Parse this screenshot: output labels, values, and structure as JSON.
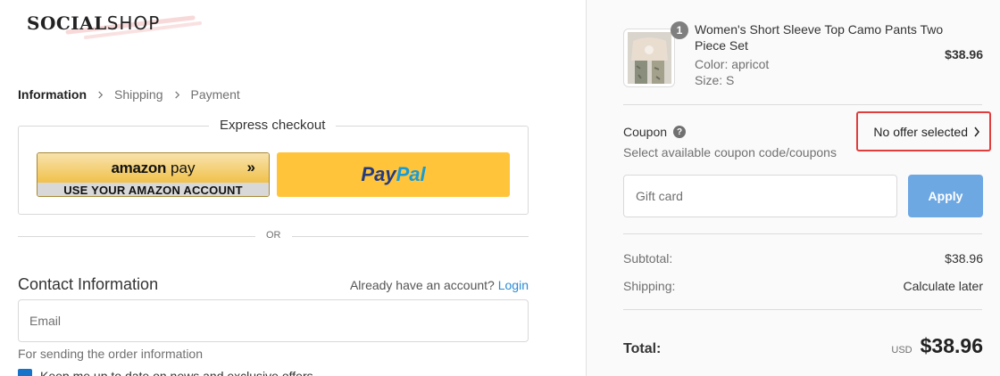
{
  "brand": {
    "logo_bold": "SOCIAL",
    "logo_light": "SHOP"
  },
  "breadcrumb": [
    {
      "label": "Information",
      "active": true
    },
    {
      "label": "Shipping",
      "active": false
    },
    {
      "label": "Payment",
      "active": false
    }
  ],
  "express": {
    "title": "Express checkout",
    "amazon_word": "amazon",
    "amazon_pay": "pay",
    "amazon_sub": "USE YOUR AMAZON ACCOUNT",
    "paypal_1": "Pay",
    "paypal_2": "Pal",
    "or_text": "OR"
  },
  "contact": {
    "title": "Contact Information",
    "account_prompt": "Already have an account?",
    "login_link": "Login",
    "email_placeholder": "Email",
    "email_hint": "For sending the order information",
    "newsletter_label": "Keep me up to date on news and exclusive offers"
  },
  "cart": {
    "quantity": "1",
    "product_name": "Women's Short Sleeve Top Camo Pants Two Piece Set",
    "option_color": "Color: apricot",
    "option_size": "Size: S",
    "price": "$38.96"
  },
  "coupon": {
    "label": "Coupon",
    "help_glyph": "?",
    "subtext": "Select available coupon code/coupons",
    "offer_button": "No offer selected"
  },
  "gift": {
    "placeholder": "Gift card",
    "apply_label": "Apply"
  },
  "summary": {
    "subtotal_label": "Subtotal:",
    "subtotal_value": "$38.96",
    "shipping_label": "Shipping:",
    "shipping_value": "Calculate later",
    "total_label": "Total:",
    "currency": "USD",
    "total_value": "$38.96"
  },
  "colors": {
    "amazon_yellow": "#f0c14b",
    "paypal_yellow": "#ffc439",
    "link_blue": "#2a8ad5",
    "apply_blue": "#6ea8e3",
    "highlight_red": "#e03d3d",
    "checkbox_blue": "#1773c9"
  },
  "icons": {
    "breadcrumb_separator": "chevron-right-icon",
    "coupon_help": "help-circle-icon",
    "offer_arrow": "chevron-right-icon",
    "amazon_arrows": "double-chevron-icon"
  }
}
